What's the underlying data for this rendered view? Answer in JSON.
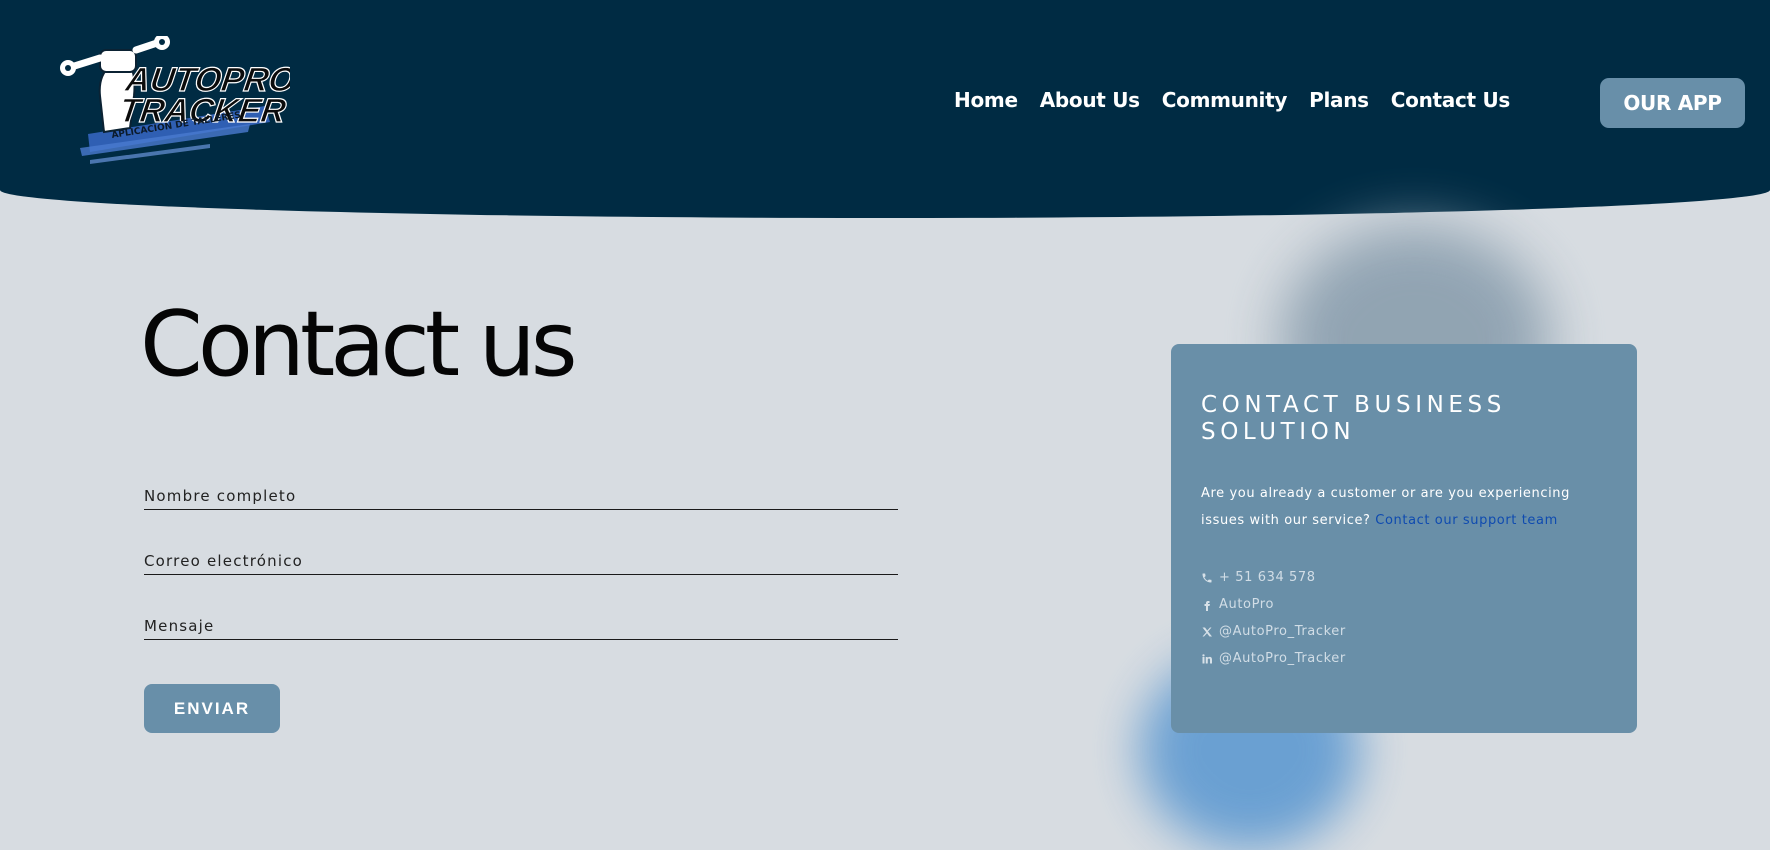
{
  "header": {
    "logo": {
      "line1": "AUTOPRO",
      "line2": "TRACKER",
      "tagline": "APLICACION DE TALLERES"
    },
    "nav": [
      {
        "label": "Home"
      },
      {
        "label": "About Us"
      },
      {
        "label": "Community"
      },
      {
        "label": "Plans"
      },
      {
        "label": "Contact Us"
      }
    ],
    "app_button": "OUR APP"
  },
  "main": {
    "title": "Contact us",
    "form": {
      "name_label": "Nombre completo",
      "email_label": "Correo electrónico",
      "message_label": "Mensaje",
      "submit_label": "ENVIAR"
    }
  },
  "card": {
    "title": "CONTACT BUSINESS SOLUTION",
    "description": "Are you already a customer or are you experiencing issues with our service?",
    "support_link": "Contact our support team",
    "contacts": [
      {
        "icon": "phone-icon",
        "text": "+ 51 634 578"
      },
      {
        "icon": "facebook-icon",
        "text": "AutoPro"
      },
      {
        "icon": "x-icon",
        "text": "@AutoPro_Tracker"
      },
      {
        "icon": "linkedin-icon",
        "text": "@AutoPro_Tracker"
      }
    ]
  },
  "colors": {
    "header_bg": "#002b43",
    "page_bg": "#d7dce1",
    "accent": "#688fa9",
    "link": "#0f4bb0"
  }
}
